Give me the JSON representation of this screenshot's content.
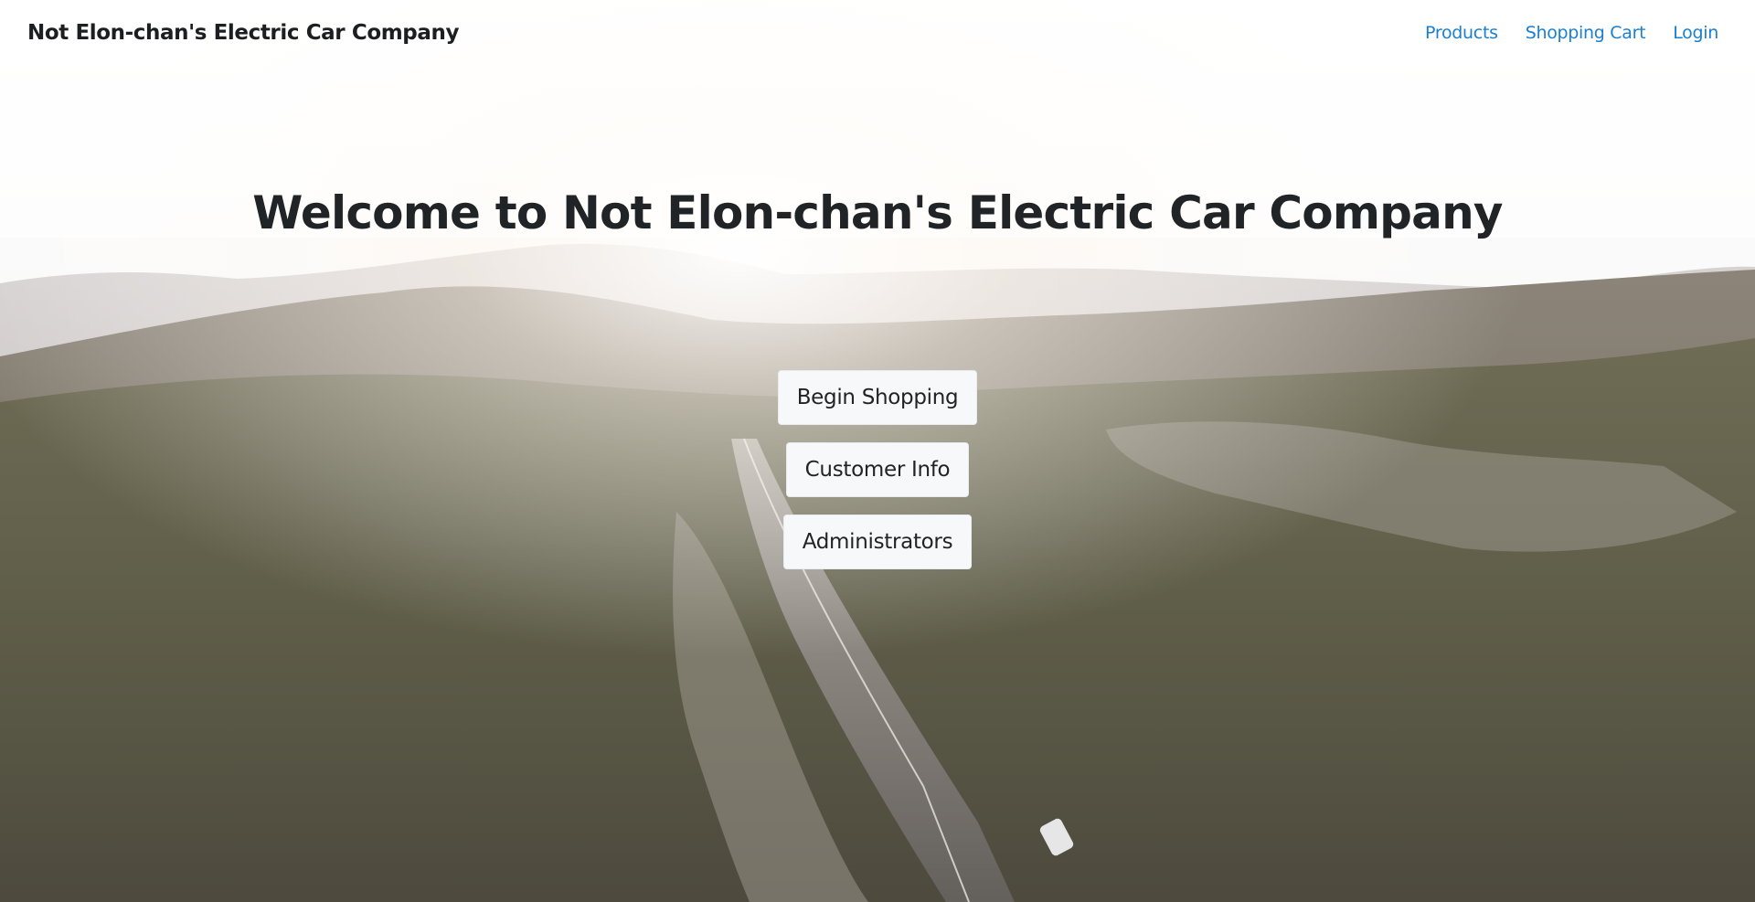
{
  "navbar": {
    "brand": "Not Elon-chan's Electric Car Company",
    "links": [
      {
        "label": "Products"
      },
      {
        "label": "Shopping Cart"
      },
      {
        "label": "Login"
      }
    ],
    "link_color": "#1a7fd0"
  },
  "hero": {
    "title": "Welcome to Not Elon-chan's Electric Car Company",
    "background": "aerial-road-through-hills-image",
    "buttons": [
      {
        "label": "Begin Shopping"
      },
      {
        "label": "Customer Info"
      },
      {
        "label": "Administrators"
      }
    ]
  }
}
